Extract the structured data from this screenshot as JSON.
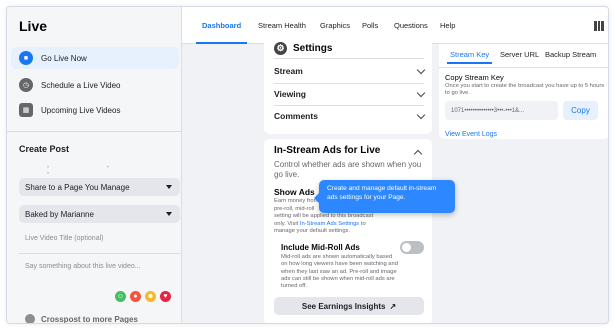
{
  "sidebar": {
    "title": "Live",
    "items": [
      {
        "label": "Go Live Now",
        "icon": "camera-icon"
      },
      {
        "label": "Schedule a Live Video",
        "icon": "clock-icon"
      },
      {
        "label": "Upcoming Live Videos",
        "icon": "calendar-icon"
      }
    ],
    "create_post": "Create Post",
    "share_select": "Share to a Page You Manage",
    "page_select": "Baked by Marianne",
    "title_placeholder": "Live Video Title (optional)",
    "description_placeholder": "Say something about this live video...",
    "bottom_label": "Crosspost to more Pages"
  },
  "tabs": [
    {
      "label": "Dashboard",
      "active": true
    },
    {
      "label": "Stream Health"
    },
    {
      "label": "Graphics"
    },
    {
      "label": "Polls"
    },
    {
      "label": "Questions"
    },
    {
      "label": "Help"
    }
  ],
  "settings": {
    "title": "Settings",
    "sections": [
      "Stream",
      "Viewing",
      "Comments"
    ]
  },
  "ads": {
    "title": "In-Stream Ads for Live",
    "subtitle": "Control whether ads are shown when you go live.",
    "show_ads_label": "Show Ads",
    "show_ads_desc_1": "Earn money from",
    "show_ads_desc_2": "pre-roll, mid-roll",
    "show_ads_desc_3": "setting will be applied to this broadcast only. Visit",
    "show_ads_link": "In-Stream Ads Settings",
    "show_ads_desc_4": "to manage your default settings.",
    "midroll_label": "Include Mid-Roll Ads",
    "midroll_desc": "Mid-roll ads are shown automatically based on how long viewers have been watching and when they last saw an ad. Pre-roll and image ads can still be shown when mid-roll ads are turned off.",
    "midroll_enabled": false,
    "earnings_button": "See Earnings Insights",
    "earnings_arrow": "↗"
  },
  "tooltip": {
    "text": "Create and manage default in-stream ads settings for your Page."
  },
  "stream_key": {
    "tabs": [
      "Stream Key",
      "Server URL",
      "Backup Stream"
    ],
    "label": "Copy Stream Key",
    "desc": "Once you start to create the broadcast you have up to 5 hours to go live.",
    "key_value": "1071••••••••••••••3•••-•••1&...",
    "copy_button": "Copy",
    "view_event_logs": "View Event Logs"
  },
  "colors": {
    "accent": "#1877f2",
    "tooltip": "#2d88ff",
    "page_bg": "#f0f2f5"
  }
}
